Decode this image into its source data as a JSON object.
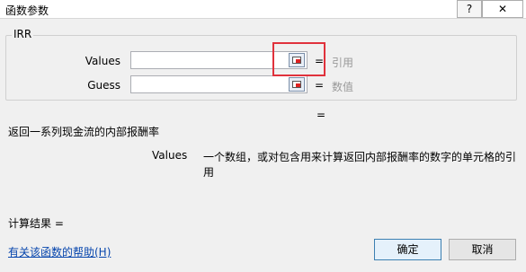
{
  "window": {
    "title": "函数参数",
    "help_glyph": "?",
    "close_glyph": "✕"
  },
  "group": {
    "name": "IRR"
  },
  "args": [
    {
      "label": "Values",
      "value": "",
      "result": "引用"
    },
    {
      "label": "Guess",
      "value": "",
      "result": "数值"
    }
  ],
  "equals": "=",
  "summary": {
    "result_eq": "=",
    "description": "返回一系列现金流的内部报酬率",
    "arg_name": "Values",
    "arg_description": "一个数组，或对包含用来计算返回内部报酬率的数字的单元格的引用"
  },
  "calc_result": "计算结果 =",
  "help_link": "有关该函数的帮助(H)",
  "buttons": {
    "ok": "确定",
    "cancel": "取消"
  },
  "icons": {
    "ref_button": "collapse-dialog-icon"
  },
  "colors": {
    "highlight": "#e0323c",
    "link": "#0645ad"
  }
}
